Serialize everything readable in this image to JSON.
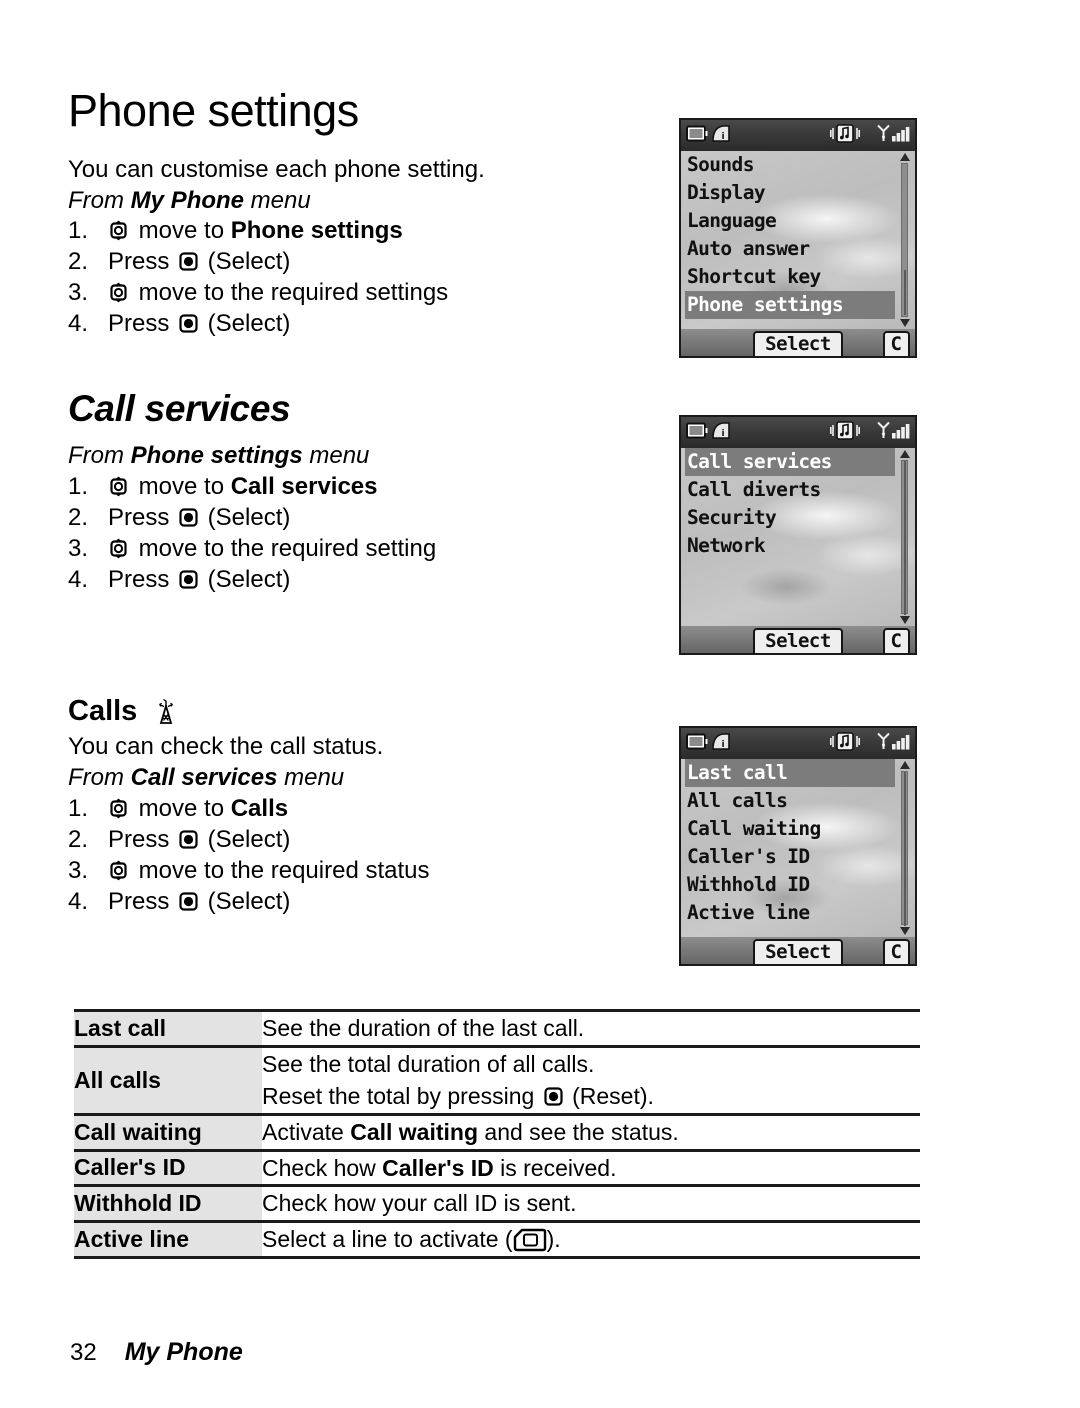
{
  "document": {
    "page_number": "32",
    "book_section": "My Phone"
  },
  "sections": [
    {
      "id": "phone-settings",
      "heading": "Phone settings",
      "heading_style": "title",
      "intro": "You can customise each phone setting.",
      "from_prefix": "From ",
      "from_bold": "My Phone",
      "from_suffix": " menu",
      "steps": [
        {
          "num": "1.",
          "icon": "nav-key",
          "pre": "",
          "post": " move to ",
          "bold": "Phone settings",
          "tail": ""
        },
        {
          "num": "2.",
          "icon": "select-key",
          "pre": "Press ",
          "post": " (Select)",
          "bold": "",
          "tail": ""
        },
        {
          "num": "3.",
          "icon": "nav-key",
          "pre": "",
          "post": " move to the required settings",
          "bold": "",
          "tail": ""
        },
        {
          "num": "4.",
          "icon": "select-key",
          "pre": "Press ",
          "post": " (Select)",
          "bold": "",
          "tail": ""
        }
      ]
    },
    {
      "id": "call-services",
      "heading": "Call services",
      "heading_style": "section",
      "intro": "",
      "from_prefix": "From ",
      "from_bold": "Phone settings",
      "from_suffix": " menu",
      "steps": [
        {
          "num": "1.",
          "icon": "nav-key",
          "pre": "",
          "post": " move to ",
          "bold": "Call services",
          "tail": ""
        },
        {
          "num": "2.",
          "icon": "select-key",
          "pre": "Press ",
          "post": " (Select)",
          "bold": "",
          "tail": ""
        },
        {
          "num": "3.",
          "icon": "nav-key",
          "pre": "",
          "post": " move to the required setting",
          "bold": "",
          "tail": ""
        },
        {
          "num": "4.",
          "icon": "select-key",
          "pre": "Press ",
          "post": " (Select)",
          "bold": "",
          "tail": ""
        }
      ]
    },
    {
      "id": "calls",
      "heading": "Calls",
      "heading_style": "subsection",
      "heading_icon": "antenna-tower-icon",
      "intro": "You can check the call status.",
      "from_prefix": "From ",
      "from_bold": "Call services",
      "from_suffix": " menu",
      "steps": [
        {
          "num": "1.",
          "icon": "nav-key",
          "pre": "",
          "post": " move to ",
          "bold": "Calls",
          "tail": ""
        },
        {
          "num": "2.",
          "icon": "select-key",
          "pre": "Press ",
          "post": " (Select)",
          "bold": "",
          "tail": ""
        },
        {
          "num": "3.",
          "icon": "nav-key",
          "pre": "",
          "post": " move to the required status",
          "bold": "",
          "tail": ""
        },
        {
          "num": "4.",
          "icon": "select-key",
          "pre": "Press ",
          "post": " (Select)",
          "bold": "",
          "tail": ""
        }
      ]
    }
  ],
  "phone_screens": [
    {
      "id": "screen-phone-settings",
      "status_icons": [
        "battery-icon",
        "info-icon",
        "vibrate-melody-icon",
        "signal-strength-icon"
      ],
      "items": [
        "Sounds",
        "Display",
        "Language",
        "Auto answer",
        "Shortcut key",
        "Phone settings"
      ],
      "highlight_index": 5,
      "scroll_thumb_top_pct": 72,
      "scroll_thumb_height_pct": 26,
      "softkey_left": "Select",
      "softkey_right": "C"
    },
    {
      "id": "screen-call-services",
      "status_icons": [
        "battery-icon",
        "info-icon",
        "vibrate-melody-icon",
        "signal-strength-icon"
      ],
      "items": [
        "Call services",
        "Call diverts",
        "Security",
        "Network"
      ],
      "highlight_index": 0,
      "scroll_thumb_top_pct": 0,
      "scroll_thumb_height_pct": 100,
      "softkey_left": "Select",
      "softkey_right": "C"
    },
    {
      "id": "screen-calls",
      "status_icons": [
        "battery-icon",
        "info-icon",
        "vibrate-melody-icon",
        "signal-strength-icon"
      ],
      "items": [
        "Last call",
        "All calls",
        "Call waiting",
        "Caller's ID",
        "Withhold ID",
        "Active line"
      ],
      "highlight_index": 0,
      "scroll_thumb_top_pct": 0,
      "scroll_thumb_height_pct": 100,
      "softkey_left": "Select",
      "softkey_right": "C"
    }
  ],
  "table": {
    "rows": [
      {
        "key": "Last call",
        "lines": [
          {
            "pre": "See the duration of the last call.",
            "bold": "",
            "post": "",
            "icon": ""
          }
        ]
      },
      {
        "key": "All calls",
        "lines": [
          {
            "pre": "See the total duration of all calls.",
            "bold": "",
            "post": "",
            "icon": ""
          },
          {
            "pre": "Reset the total by pressing ",
            "bold": "",
            "post": " (Reset).",
            "icon": "select-key"
          }
        ]
      },
      {
        "key": "Call waiting",
        "lines": [
          {
            "pre": "Activate ",
            "bold": "Call waiting",
            "post": " and see the status.",
            "icon": ""
          }
        ]
      },
      {
        "key": "Caller's ID",
        "lines": [
          {
            "pre": "Check how ",
            "bold": "Caller's ID",
            "post": " is received.",
            "icon": ""
          }
        ]
      },
      {
        "key": "Withhold ID",
        "lines": [
          {
            "pre": "Check how your call ID is sent.",
            "bold": "",
            "post": "",
            "icon": ""
          }
        ]
      },
      {
        "key": "Active line",
        "lines": [
          {
            "pre": "Select a line to activate (",
            "bold": "",
            "post": ").",
            "icon": "sim-card-icon"
          }
        ]
      }
    ]
  },
  "colors": {
    "page_background": "#ffffff",
    "text": "#000000",
    "table_key_cell": "#e3e3e3",
    "table_rule": "#1a1a1a",
    "screen_background": "#c3c3c3",
    "screen_statusbar": "#333333",
    "screen_highlight": "#7c7c7c"
  }
}
